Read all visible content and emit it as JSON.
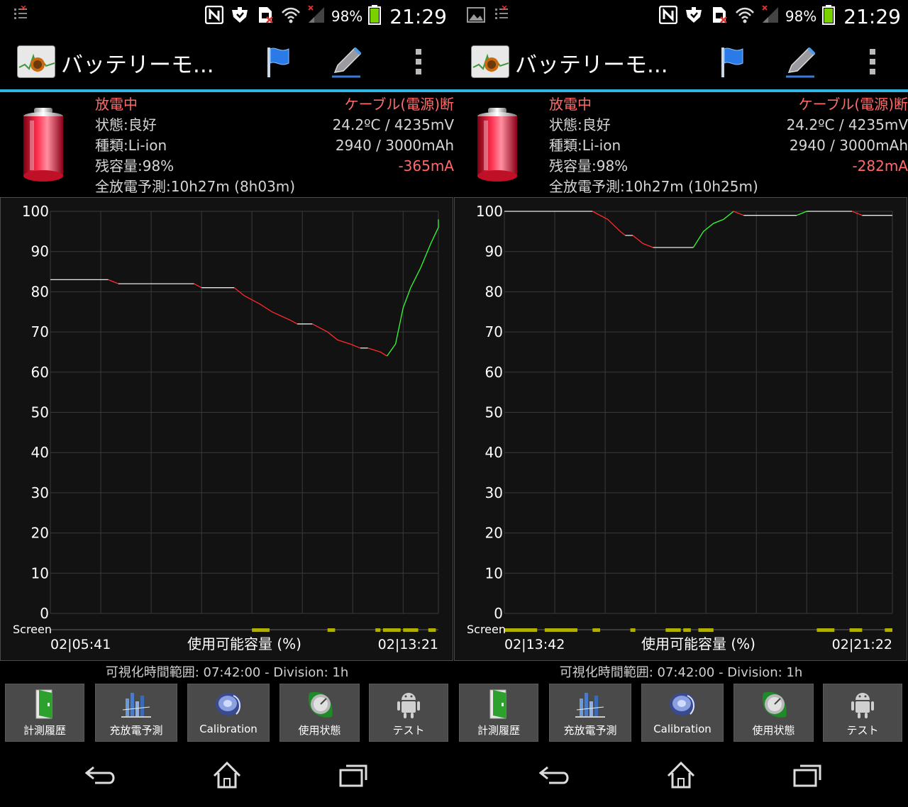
{
  "colors": {
    "accent_rule": "#33b5e5",
    "discharge_line": "#ff2a2a",
    "charge_line": "#33ff33",
    "flat_line": "#e8e8e8",
    "screen_on": "#b0b000",
    "alert_text": "#ff6a6a"
  },
  "panels": [
    {
      "status_bar": {
        "icons_left": [
          "notification-list-icon"
        ],
        "icons_right": [
          "nfc-icon",
          "smart-connect-icon",
          "sim-missing-icon",
          "wifi-icon",
          "signal-icon",
          "battery-status-icon"
        ],
        "battery_percent": "98%",
        "time": "21:29"
      },
      "action_bar": {
        "title": "バッテリーモ...",
        "actions": [
          "flag-icon",
          "edit-icon",
          "overflow-menu-icon"
        ]
      },
      "info": {
        "state": "放電中",
        "health": "状態:良好",
        "type": "種類:Li-ion",
        "level": "残容量:98%",
        "estimate": "全放電予測:10h27m (8h03m)",
        "cable": "ケーブル(電源)断",
        "temp_voltage": "24.2ºC / 4235mV",
        "capacity": "2940 / 3000mAh",
        "current": "-365mA"
      },
      "graph": {
        "screen_label": "Screen",
        "start_time": "02|05:41",
        "end_time": "02|13:21",
        "xlabel": "使用可能容量 (%)"
      },
      "range_text": "可視化時間範囲: 07:42:00 - Division: 1h",
      "tab_buttons": [
        {
          "label": "計測履歴",
          "icon": "measurement-history-icon"
        },
        {
          "label": "充放電予測",
          "icon": "charge-forecast-icon"
        },
        {
          "label": "Calibration",
          "icon": "calibration-disc-icon"
        },
        {
          "label": "使用状態",
          "icon": "usage-gauge-icon"
        },
        {
          "label": "テスト",
          "icon": "android-robot-icon"
        }
      ],
      "nav": [
        "back-icon",
        "home-icon",
        "recent-apps-icon"
      ]
    },
    {
      "status_bar": {
        "icons_left": [
          "image-icon",
          "notification-list-icon"
        ],
        "icons_right": [
          "nfc-icon",
          "smart-connect-icon",
          "sim-missing-icon",
          "wifi-icon",
          "signal-icon",
          "battery-status-icon"
        ],
        "battery_percent": "98%",
        "time": "21:29"
      },
      "action_bar": {
        "title": "バッテリーモ...",
        "actions": [
          "flag-icon",
          "edit-icon",
          "overflow-menu-icon"
        ]
      },
      "info": {
        "state": "放電中",
        "health": "状態:良好",
        "type": "種類:Li-ion",
        "level": "残容量:98%",
        "estimate": "全放電予測:10h27m (10h25m)",
        "cable": "ケーブル(電源)断",
        "temp_voltage": "24.2ºC / 4235mV",
        "capacity": "2940 / 3000mAh",
        "current": "-282mA"
      },
      "graph": {
        "screen_label": "Screen",
        "start_time": "02|13:42",
        "end_time": "02|21:22",
        "xlabel": "使用可能容量 (%)"
      },
      "range_text": "可視化時間範囲: 07:42:00 - Division: 1h",
      "tab_buttons": [
        {
          "label": "計測履歴",
          "icon": "measurement-history-icon"
        },
        {
          "label": "充放電予測",
          "icon": "charge-forecast-icon"
        },
        {
          "label": "Calibration",
          "icon": "calibration-disc-icon"
        },
        {
          "label": "使用状態",
          "icon": "usage-gauge-icon"
        },
        {
          "label": "テスト",
          "icon": "android-robot-icon"
        }
      ],
      "nav": [
        "back-icon",
        "home-icon",
        "recent-apps-icon"
      ]
    }
  ],
  "chart_data": [
    {
      "type": "line",
      "xlabel": "使用可能容量 (%)",
      "ylim": [
        0,
        100
      ],
      "yticks": [
        "100",
        "90",
        "80",
        "70",
        "60",
        "50",
        "40",
        "30",
        "20",
        "10",
        "0"
      ],
      "xlim_hours": [
        0,
        7.7
      ],
      "x_start": "02|05:41",
      "x_end": "02|13:21",
      "grid": true,
      "segments": [
        {
          "state": "flat",
          "points": [
            [
              0,
              83
            ],
            [
              1.15,
              83
            ]
          ]
        },
        {
          "state": "discharge",
          "points": [
            [
              1.15,
              83
            ],
            [
              1.35,
              82
            ]
          ]
        },
        {
          "state": "flat",
          "points": [
            [
              1.35,
              82
            ],
            [
              2.85,
              82
            ]
          ]
        },
        {
          "state": "discharge",
          "points": [
            [
              2.85,
              82
            ],
            [
              3.0,
              81
            ]
          ]
        },
        {
          "state": "flat",
          "points": [
            [
              3.0,
              81
            ],
            [
              3.65,
              81
            ]
          ]
        },
        {
          "state": "discharge",
          "points": [
            [
              3.65,
              81
            ],
            [
              3.85,
              79
            ],
            [
              4.15,
              77
            ],
            [
              4.4,
              75
            ],
            [
              4.75,
              73
            ],
            [
              4.9,
              72
            ]
          ]
        },
        {
          "state": "flat",
          "points": [
            [
              4.9,
              72
            ],
            [
              5.2,
              72
            ]
          ]
        },
        {
          "state": "discharge",
          "points": [
            [
              5.2,
              72
            ],
            [
              5.5,
              70
            ],
            [
              5.7,
              68
            ],
            [
              5.95,
              67
            ],
            [
              6.15,
              66
            ]
          ]
        },
        {
          "state": "flat",
          "points": [
            [
              6.15,
              66
            ],
            [
              6.3,
              66
            ]
          ]
        },
        {
          "state": "discharge",
          "points": [
            [
              6.3,
              66
            ],
            [
              6.55,
              65
            ],
            [
              6.68,
              64
            ]
          ]
        },
        {
          "state": "charge",
          "points": [
            [
              6.68,
              64
            ],
            [
              6.85,
              67
            ],
            [
              7.0,
              76
            ],
            [
              7.15,
              81
            ],
            [
              7.35,
              86
            ],
            [
              7.55,
              92
            ],
            [
              7.8,
              96
            ],
            [
              7.95,
              98
            ]
          ]
        },
        {
          "state": "flat",
          "points": [
            [
              7.95,
              98
            ],
            [
              8.1,
              98
            ]
          ]
        }
      ],
      "screen_on": [
        [
          4.0,
          4.35
        ],
        [
          5.5,
          5.65
        ],
        [
          6.45,
          6.55
        ],
        [
          6.6,
          6.95
        ],
        [
          7.0,
          7.3
        ],
        [
          7.5,
          7.65
        ]
      ]
    },
    {
      "type": "line",
      "xlabel": "使用可能容量 (%)",
      "ylim": [
        0,
        100
      ],
      "yticks": [
        "100",
        "90",
        "80",
        "70",
        "60",
        "50",
        "40",
        "30",
        "20",
        "10",
        "0"
      ],
      "xlim_hours": [
        0,
        7.7
      ],
      "x_start": "02|13:42",
      "x_end": "02|21:22",
      "grid": true,
      "segments": [
        {
          "state": "flat",
          "points": [
            [
              0,
              100
            ],
            [
              1.75,
              100
            ]
          ]
        },
        {
          "state": "discharge",
          "points": [
            [
              1.75,
              100
            ],
            [
              2.05,
              98
            ],
            [
              2.3,
              95
            ],
            [
              2.4,
              94
            ]
          ]
        },
        {
          "state": "flat",
          "points": [
            [
              2.4,
              94
            ],
            [
              2.55,
              94
            ]
          ]
        },
        {
          "state": "discharge",
          "points": [
            [
              2.55,
              94
            ],
            [
              2.75,
              92
            ],
            [
              2.95,
              91
            ]
          ]
        },
        {
          "state": "flat",
          "points": [
            [
              2.95,
              91
            ],
            [
              3.75,
              91
            ]
          ]
        },
        {
          "state": "charge",
          "points": [
            [
              3.75,
              91
            ],
            [
              3.95,
              95
            ],
            [
              4.15,
              97
            ],
            [
              4.35,
              98
            ],
            [
              4.55,
              100
            ]
          ]
        },
        {
          "state": "discharge",
          "points": [
            [
              4.55,
              100
            ],
            [
              4.75,
              99
            ]
          ]
        },
        {
          "state": "flat",
          "points": [
            [
              4.75,
              99
            ],
            [
              5.8,
              99
            ]
          ]
        },
        {
          "state": "charge",
          "points": [
            [
              5.8,
              99
            ],
            [
              6.0,
              100
            ]
          ]
        },
        {
          "state": "flat",
          "points": [
            [
              6.0,
              100
            ],
            [
              6.9,
              100
            ]
          ]
        },
        {
          "state": "discharge",
          "points": [
            [
              6.9,
              100
            ],
            [
              7.1,
              99
            ]
          ]
        },
        {
          "state": "flat",
          "points": [
            [
              7.1,
              99
            ],
            [
              8.1,
              99
            ]
          ]
        }
      ],
      "screen_on": [
        [
          0,
          0.65
        ],
        [
          0.8,
          1.45
        ],
        [
          1.75,
          1.9
        ],
        [
          2.5,
          2.6
        ],
        [
          3.2,
          3.5
        ],
        [
          3.55,
          3.7
        ],
        [
          3.85,
          4.15
        ],
        [
          6.2,
          6.55
        ],
        [
          6.85,
          7.1
        ],
        [
          7.55,
          7.7
        ]
      ]
    }
  ]
}
